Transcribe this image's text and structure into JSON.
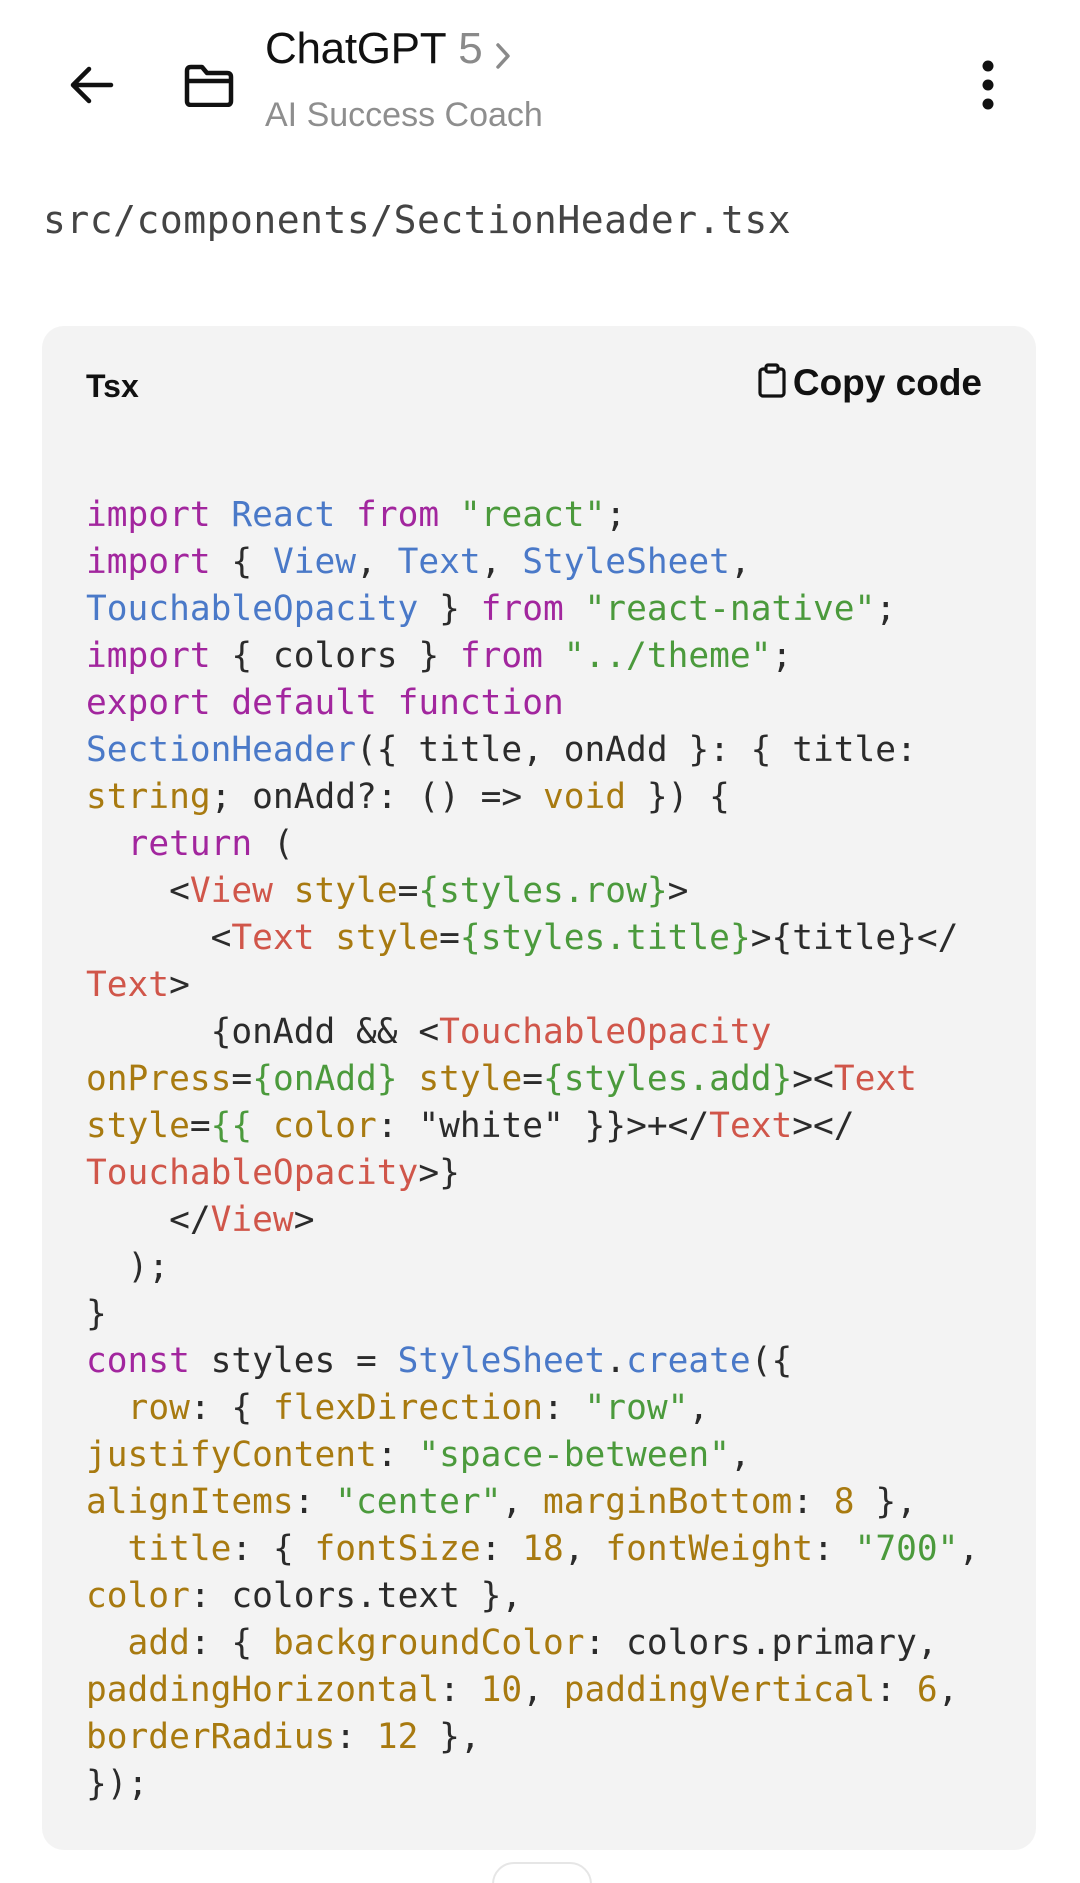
{
  "header": {
    "back_icon": "arrow-left-icon",
    "folder_icon": "folder-icon",
    "app_name": "ChatGPT",
    "model_version": "5",
    "chevron_icon": "chevron-right-icon",
    "subtitle": "AI Success Coach",
    "more_icon": "more-vertical-icon"
  },
  "file_path": "src/components/SectionHeader.tsx",
  "code_block": {
    "language": "Tsx",
    "copy_label": "Copy code",
    "copy_icon": "clipboard-icon",
    "lines": [
      [
        [
          "kw",
          "import"
        ],
        [
          "pl",
          " "
        ],
        [
          "fn",
          "React"
        ],
        [
          "pl",
          " "
        ],
        [
          "kw",
          "from"
        ],
        [
          "pl",
          " "
        ],
        [
          "str",
          "\"react\""
        ],
        [
          "pl",
          ";"
        ]
      ],
      [
        [
          "kw",
          "import"
        ],
        [
          "pl",
          " { "
        ],
        [
          "fn",
          "View"
        ],
        [
          "pl",
          ", "
        ],
        [
          "fn",
          "Text"
        ],
        [
          "pl",
          ", "
        ],
        [
          "fn",
          "StyleSheet"
        ],
        [
          "pl",
          ","
        ]
      ],
      [
        [
          "fn",
          "TouchableOpacity"
        ],
        [
          "pl",
          " } "
        ],
        [
          "kw",
          "from"
        ],
        [
          "pl",
          " "
        ],
        [
          "str",
          "\"react-native\""
        ],
        [
          "pl",
          ";"
        ]
      ],
      [
        [
          "kw",
          "import"
        ],
        [
          "pl",
          " { colors } "
        ],
        [
          "kw",
          "from"
        ],
        [
          "pl",
          " "
        ],
        [
          "str",
          "\"../theme\""
        ],
        [
          "pl",
          ";"
        ]
      ],
      [
        [
          "kw",
          "export"
        ],
        [
          "pl",
          " "
        ],
        [
          "kw",
          "default"
        ],
        [
          "pl",
          " "
        ],
        [
          "kw",
          "function"
        ]
      ],
      [
        [
          "fn",
          "SectionHeader"
        ],
        [
          "pl",
          "({ title, onAdd }: { title:"
        ]
      ],
      [
        [
          "at",
          "string"
        ],
        [
          "pl",
          "; onAdd?: () => "
        ],
        [
          "at",
          "void"
        ],
        [
          "pl",
          " }) {"
        ]
      ],
      [
        [
          "pl",
          "  "
        ],
        [
          "kw",
          "return"
        ],
        [
          "pl",
          " ("
        ]
      ],
      [
        [
          "pl",
          "    <"
        ],
        [
          "tag",
          "View"
        ],
        [
          "pl",
          " "
        ],
        [
          "at",
          "style"
        ],
        [
          "pl",
          "="
        ],
        [
          "str",
          "{styles.row}"
        ],
        [
          "pl",
          ">"
        ]
      ],
      [
        [
          "pl",
          "      <"
        ],
        [
          "tag",
          "Text"
        ],
        [
          "pl",
          " "
        ],
        [
          "at",
          "style"
        ],
        [
          "pl",
          "="
        ],
        [
          "str",
          "{styles.title}"
        ],
        [
          "pl",
          ">{title}</"
        ]
      ],
      [
        [
          "tag",
          "Text"
        ],
        [
          "pl",
          ">"
        ]
      ],
      [
        [
          "pl",
          "      {onAdd && <"
        ],
        [
          "tag",
          "TouchableOpacity"
        ]
      ],
      [
        [
          "at",
          "onPress"
        ],
        [
          "pl",
          "="
        ],
        [
          "str",
          "{onAdd}"
        ],
        [
          "pl",
          " "
        ],
        [
          "at",
          "style"
        ],
        [
          "pl",
          "="
        ],
        [
          "str",
          "{styles.add}"
        ],
        [
          "pl",
          "><"
        ],
        [
          "tag",
          "Text"
        ]
      ],
      [
        [
          "at",
          "style"
        ],
        [
          "pl",
          "="
        ],
        [
          "str",
          "{{"
        ],
        [
          "pl",
          " "
        ],
        [
          "at",
          "color"
        ],
        [
          "pl",
          ": \"white\" }}>+</"
        ],
        [
          "tag",
          "Text"
        ],
        [
          "pl",
          "></"
        ]
      ],
      [
        [
          "tag",
          "TouchableOpacity"
        ],
        [
          "pl",
          ">}"
        ]
      ],
      [
        [
          "pl",
          "    </"
        ],
        [
          "tag",
          "View"
        ],
        [
          "pl",
          ">"
        ]
      ],
      [
        [
          "pl",
          "  );"
        ]
      ],
      [
        [
          "pl",
          "}"
        ]
      ],
      [
        [
          "kw",
          "const"
        ],
        [
          "pl",
          " styles = "
        ],
        [
          "fn",
          "StyleSheet"
        ],
        [
          "pl",
          "."
        ],
        [
          "fn",
          "create"
        ],
        [
          "pl",
          "({"
        ]
      ],
      [
        [
          "pl",
          "  "
        ],
        [
          "at",
          "row"
        ],
        [
          "pl",
          ": { "
        ],
        [
          "at",
          "flexDirection"
        ],
        [
          "pl",
          ": "
        ],
        [
          "str",
          "\"row\""
        ],
        [
          "pl",
          ","
        ]
      ],
      [
        [
          "at",
          "justifyContent"
        ],
        [
          "pl",
          ": "
        ],
        [
          "str",
          "\"space-between\""
        ],
        [
          "pl",
          ","
        ]
      ],
      [
        [
          "at",
          "alignItems"
        ],
        [
          "pl",
          ": "
        ],
        [
          "str",
          "\"center\""
        ],
        [
          "pl",
          ", "
        ],
        [
          "at",
          "marginBottom"
        ],
        [
          "pl",
          ": "
        ],
        [
          "at",
          "8"
        ],
        [
          "pl",
          " },"
        ]
      ],
      [
        [
          "pl",
          "  "
        ],
        [
          "at",
          "title"
        ],
        [
          "pl",
          ": { "
        ],
        [
          "at",
          "fontSize"
        ],
        [
          "pl",
          ": "
        ],
        [
          "at",
          "18"
        ],
        [
          "pl",
          ", "
        ],
        [
          "at",
          "fontWeight"
        ],
        [
          "pl",
          ": "
        ],
        [
          "str",
          "\"700\""
        ],
        [
          "pl",
          ","
        ]
      ],
      [
        [
          "at",
          "color"
        ],
        [
          "pl",
          ": colors.text },"
        ]
      ],
      [
        [
          "pl",
          "  "
        ],
        [
          "at",
          "add"
        ],
        [
          "pl",
          ": { "
        ],
        [
          "at",
          "backgroundColor"
        ],
        [
          "pl",
          ": colors.primary,"
        ]
      ],
      [
        [
          "at",
          "paddingHorizontal"
        ],
        [
          "pl",
          ": "
        ],
        [
          "at",
          "10"
        ],
        [
          "pl",
          ", "
        ],
        [
          "at",
          "paddingVertical"
        ],
        [
          "pl",
          ": "
        ],
        [
          "at",
          "6"
        ],
        [
          "pl",
          ","
        ]
      ],
      [
        [
          "at",
          "borderRadius"
        ],
        [
          "pl",
          ": "
        ],
        [
          "at",
          "12"
        ],
        [
          "pl",
          " },"
        ]
      ],
      [
        [
          "pl",
          "});"
        ]
      ]
    ]
  },
  "colors": {
    "keyword": "#a2269e",
    "identifier": "#4a79c8",
    "string": "#4b9a3c",
    "jsx_tag": "#d0564a",
    "attribute": "#a87a10",
    "plain": "#2b2b2b",
    "card_background": "#f3f3f3"
  }
}
